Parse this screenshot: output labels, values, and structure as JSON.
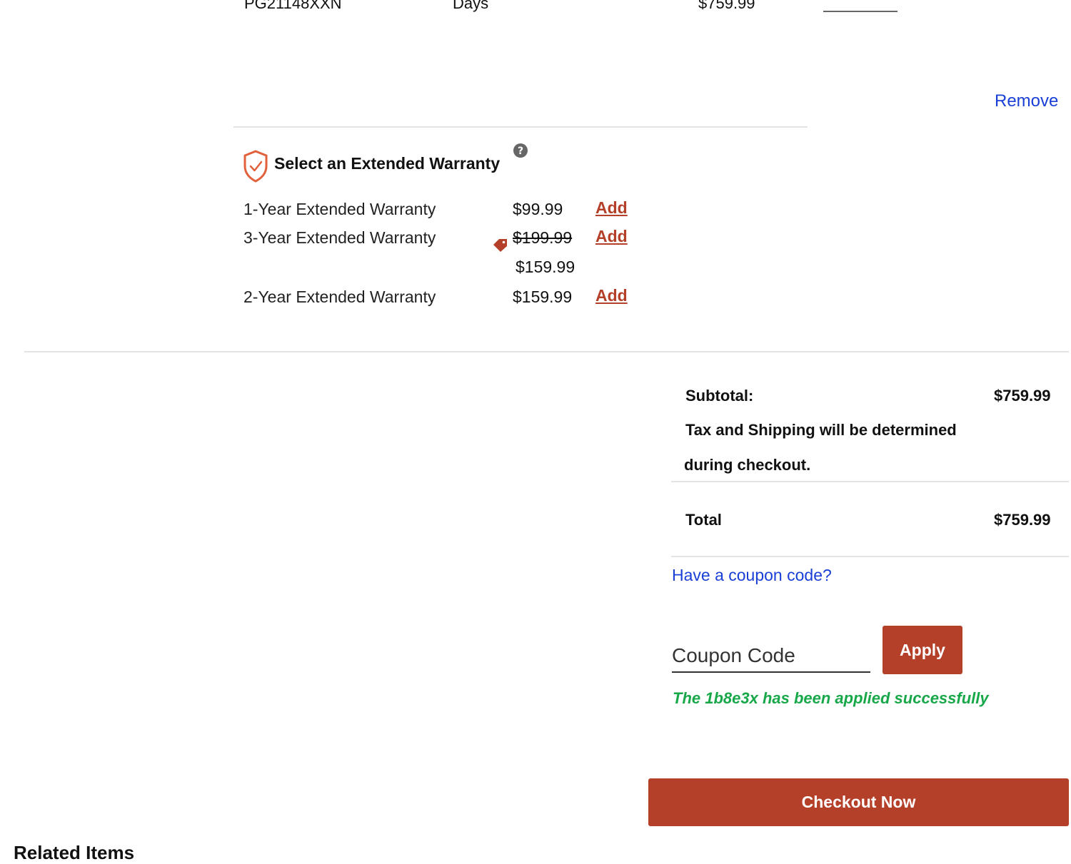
{
  "cart_item": {
    "sku": "PG21148XXN",
    "days_text": "Days",
    "price": "$759.99",
    "remove_label": "Remove"
  },
  "warranty": {
    "heading": "Select an Extended Warranty",
    "help_icon": "question-circle-icon",
    "shield_icon": "shield-check-icon",
    "options": [
      {
        "label": "1-Year Extended Warranty",
        "price": "$99.99",
        "action": "Add"
      },
      {
        "label": "3-Year Extended Warranty",
        "original_price": "$199.99",
        "sale_price": "$159.99",
        "action": "Add"
      },
      {
        "label": "2-Year Extended Warranty",
        "price": "$159.99",
        "action": "Add"
      }
    ]
  },
  "summary": {
    "subtotal_label": "Subtotal:",
    "subtotal_value": "$759.99",
    "tax_note_line1": "Tax and Shipping will be determined",
    "tax_note_line2": "during checkout.",
    "total_label": "Total",
    "total_value": "$759.99"
  },
  "coupon": {
    "link_text": "Have a coupon code?",
    "placeholder": "Coupon Code",
    "apply_label": "Apply",
    "success_message": "The 1b8e3x has been applied successfully"
  },
  "checkout": {
    "label": "Checkout Now"
  },
  "related": {
    "title": "Related Items"
  },
  "colors": {
    "accent": "#b5402a",
    "link": "#1a3fd6",
    "success": "#18a84a"
  }
}
